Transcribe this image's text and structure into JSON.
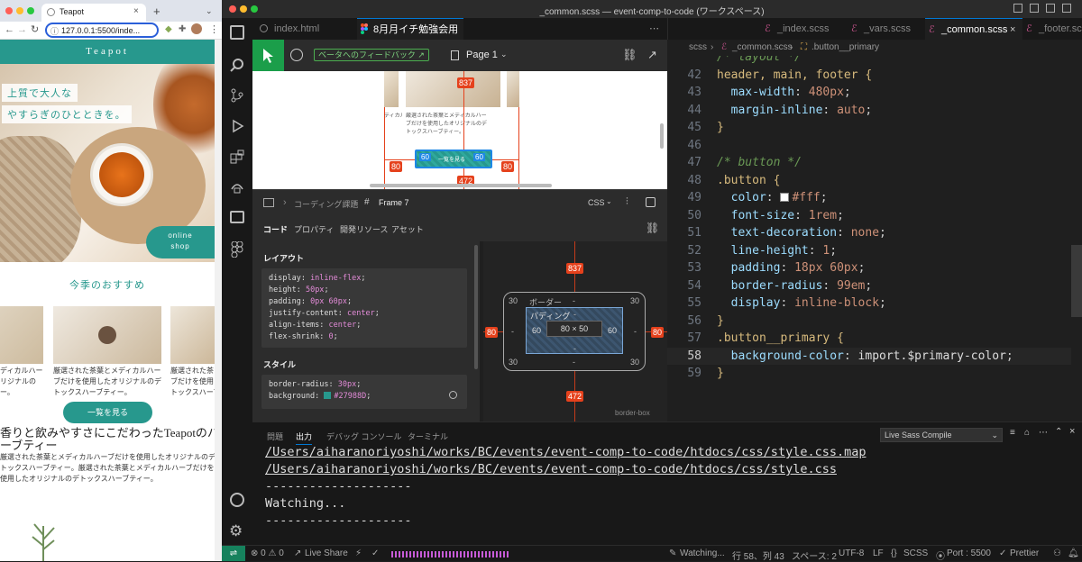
{
  "browser": {
    "tab_title": "Teapot",
    "address": "127.0.0.1:5500/inde...",
    "site": {
      "logo": "Teapot",
      "hero_line1": "上質で大人な",
      "hero_line2": "やすらぎのひとときを。",
      "online_shop_1": "online",
      "online_shop_2": "shop",
      "section_title": "今季のおすすめ",
      "card_texts": [
        [
          "ディカルハー",
          "リジナルの",
          "ー。"
        ],
        [
          "厳選された茶葉とメディカルハー",
          "ブだけを使用したオリジナルのデ",
          "トックスハーブティー。"
        ],
        [
          "厳選された茶",
          "ブだけを使用",
          "トックスハーブ"
        ]
      ],
      "button_label": "一覧を見る",
      "heading_1": "香りと飲みやすさにこだわったTeapotのハ",
      "heading_2": "ーブティー",
      "body_1": "厳選された茶葉とメディカルハーブだけを使用したオリジナルのデ",
      "body_2": "トックスハーブティー。厳選された茶葉とメディカルハーブだけを",
      "body_3": "使用したオリジナルのデトックスハーブティー。"
    }
  },
  "vscode": {
    "window_title": "_common.scss — event-comp-to-code (ワークスペース)",
    "left_tabs": [
      "index.html",
      "8月月イチ勉強会用"
    ],
    "right_tabs": [
      "_index.scss",
      "_vars.scss",
      "_common.scss",
      "_footer.scss"
    ],
    "breadcrumb": [
      "scss",
      "_common.scss",
      ".button__primary"
    ],
    "figma": {
      "feedback": "ベータへのフィードバック",
      "page": "Page 1",
      "crumb_parent": "コーディング課題",
      "frame": "Frame 7",
      "lang": "CSS",
      "tabs": [
        "コード",
        "プロパティ",
        "開発リソース",
        "アセット"
      ],
      "layout_title": "レイアウト",
      "layout_code": [
        [
          "display",
          "inline-flex"
        ],
        [
          "height",
          "50px"
        ],
        [
          "padding",
          "0px 60px"
        ],
        [
          "justify-content",
          "center"
        ],
        [
          "align-items",
          "center"
        ],
        [
          "flex-shrink",
          "0"
        ]
      ],
      "style_title": "スタイル",
      "style_code": [
        [
          "border-radius",
          "30px"
        ],
        [
          "background",
          "#27988D"
        ]
      ],
      "canvas_button": "一覧を見る",
      "m_837": "837",
      "m_472": "472",
      "m_80": "80",
      "m_60": "60",
      "m_30": "30",
      "m_dash": "-",
      "box_border": "ボーダー",
      "box_padding": "パディング",
      "box_size": "80 × 50",
      "box_mode": "border-box"
    },
    "code_lines": [
      {
        "n": "",
        "t": "/* layout */"
      },
      {
        "n": "42",
        "t": "header, main, footer {"
      },
      {
        "n": "43",
        "t": "  max-width: 480px;"
      },
      {
        "n": "44",
        "t": "  margin-inline: auto;"
      },
      {
        "n": "45",
        "t": "}"
      },
      {
        "n": "46",
        "t": ""
      },
      {
        "n": "47",
        "t": "/* button */"
      },
      {
        "n": "48",
        "t": ".button {"
      },
      {
        "n": "49",
        "t": "  color: #fff;"
      },
      {
        "n": "50",
        "t": "  font-size: 1rem;"
      },
      {
        "n": "51",
        "t": "  text-decoration: none;"
      },
      {
        "n": "52",
        "t": "  line-height: 1;"
      },
      {
        "n": "53",
        "t": "  padding: 18px 60px;"
      },
      {
        "n": "54",
        "t": "  border-radius: 99em;"
      },
      {
        "n": "55",
        "t": "  display: inline-block;"
      },
      {
        "n": "56",
        "t": "}"
      },
      {
        "n": "57",
        "t": ".button__primary {"
      },
      {
        "n": "58",
        "t": "  background-color: import.$primary-color;"
      },
      {
        "n": "59",
        "t": "}"
      }
    ],
    "panel_tabs": [
      "問題",
      "出力",
      "デバッグ コンソール",
      "ターミナル"
    ],
    "panel_dropdown": "Live Sass Compile",
    "output_lines": [
      "/Users/aiharanoriyoshi/works/BC/events/event-comp-to-code/htdocs/css/style.css.map",
      "/Users/aiharanoriyoshi/works/BC/events/event-comp-to-code/htdocs/css/style.css",
      "--------------------",
      "Watching...",
      "--------------------"
    ],
    "status": {
      "problems": "⊗ 0 ⚠ 0",
      "live_share": "Live Share",
      "watching": "Watching...",
      "position": "行 58、列 43",
      "spaces": "スペース: 2",
      "encoding": "UTF-8",
      "eol": "LF",
      "lang": "SCSS",
      "port": "Port : 5500",
      "prettier": "Prettier"
    }
  }
}
